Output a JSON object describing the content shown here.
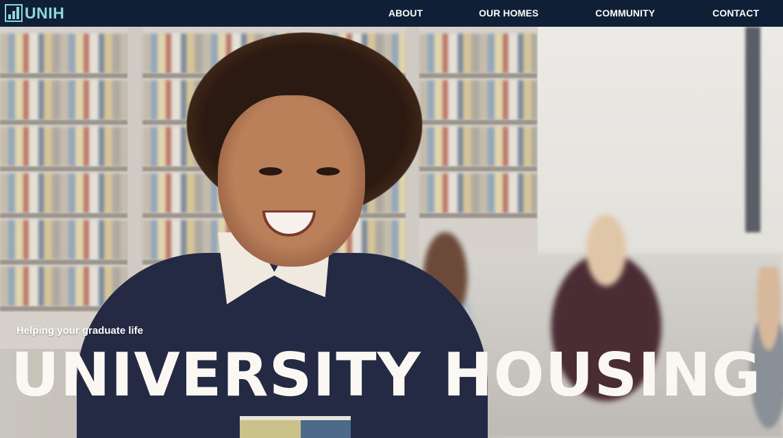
{
  "brand": {
    "logo_text": "UNIH",
    "logo_icon": "bar-chart-icon",
    "accent_color": "#8fd6de",
    "nav_background": "#0f1f36"
  },
  "nav": {
    "links": [
      {
        "label": "ABOUT"
      },
      {
        "label": "OUR HOMES"
      },
      {
        "label": "COMMUNITY"
      },
      {
        "label": "CONTACT"
      }
    ]
  },
  "hero": {
    "tagline": "Helping your graduate life",
    "headline": "UNIVERSITY HOUSING",
    "headline_color": "#fbf7f2"
  }
}
